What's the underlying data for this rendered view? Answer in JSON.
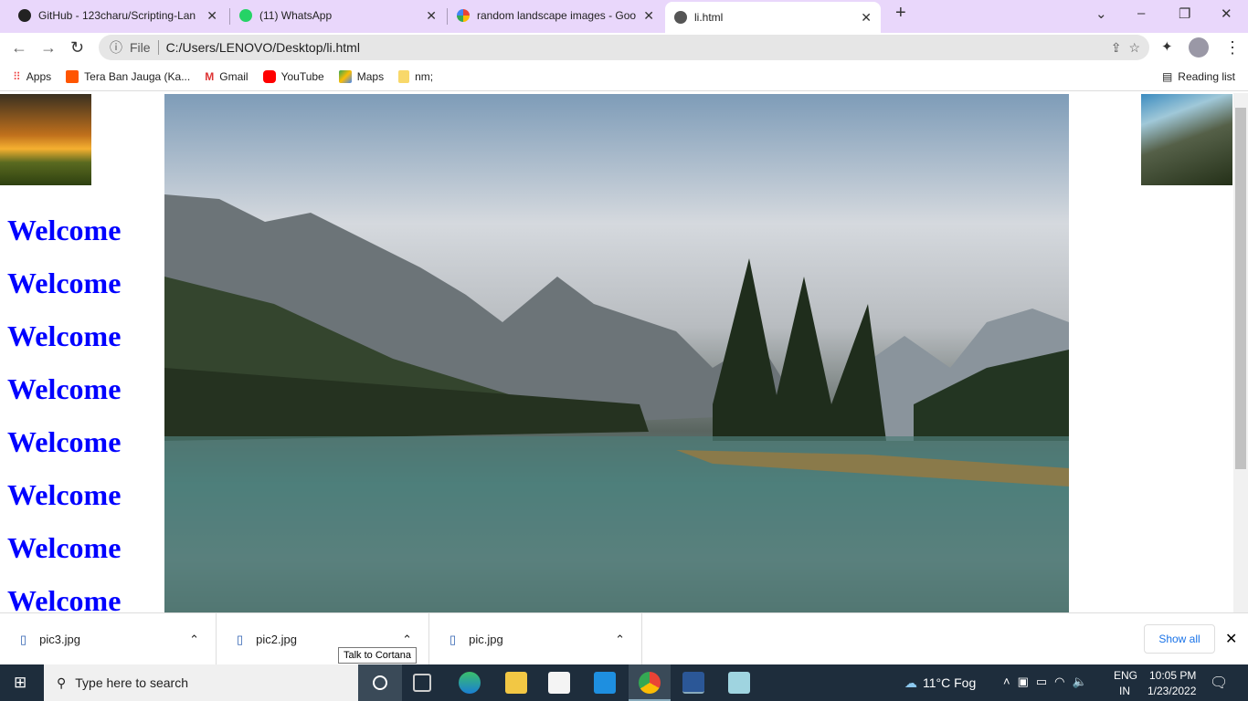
{
  "tabs": [
    {
      "title": "GitHub - 123charu/Scripting-Lan",
      "icon": "github-icon"
    },
    {
      "title": "(11) WhatsApp",
      "icon": "whatsapp-icon"
    },
    {
      "title": "random landscape images - Goo",
      "icon": "google-icon"
    },
    {
      "title": "li.html",
      "icon": "globe-icon",
      "active": true
    }
  ],
  "address": {
    "scheme": "File",
    "url": "C:/Users/LENOVO/Desktop/li.html"
  },
  "bookmarks": [
    "Apps",
    "Tera Ban Jauga (Ka...",
    "Gmail",
    "YouTube",
    "Maps",
    "nm;"
  ],
  "reading_list": "Reading list",
  "page": {
    "headings": [
      "Welcome",
      "Welcome",
      "Welcome",
      "Welcome",
      "Welcome",
      "Welcome",
      "Welcome",
      "Welcome"
    ]
  },
  "downloads": {
    "items": [
      "pic3.jpg",
      "pic2.jpg",
      "pic.jpg"
    ],
    "show_all": "Show all"
  },
  "tooltip": "Talk to Cortana",
  "taskbar": {
    "search_placeholder": "Type here to search",
    "weather": "11°C  Fog",
    "lang1": "ENG",
    "lang2": "IN",
    "time": "10:05 PM",
    "date": "1/23/2022"
  }
}
